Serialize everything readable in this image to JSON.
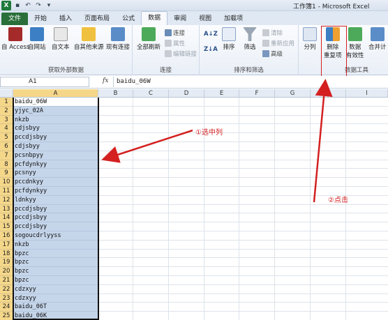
{
  "window": {
    "title": "工作簿1 - Microsoft Excel",
    "app_logo": "X"
  },
  "tabs": [
    {
      "label": "文件"
    },
    {
      "label": "开始"
    },
    {
      "label": "插入"
    },
    {
      "label": "页面布局"
    },
    {
      "label": "公式"
    },
    {
      "label": "数据"
    },
    {
      "label": "审阅"
    },
    {
      "label": "视图"
    },
    {
      "label": "加载项"
    }
  ],
  "ribbon": {
    "external_group": {
      "label": "获取外部数据",
      "access": "自 Access",
      "web": "自网站",
      "text": "自文本",
      "other": "自其他来源",
      "existing": "现有连接"
    },
    "connections_group": {
      "label": "连接",
      "refresh_all": "全部刷新",
      "connections": "连接",
      "properties": "属性",
      "edit_links": "编辑链接"
    },
    "sort_group": {
      "label": "排序和筛选",
      "sort_az": "A↓Z",
      "sort_za": "Z↓A",
      "sort": "排序",
      "filter": "筛选",
      "clear": "清除",
      "reapply": "重新应用",
      "advanced": "高级"
    },
    "tools_group": {
      "label": "数据工具",
      "text_to_columns": "分列",
      "remove_dup_line1": "删除",
      "remove_dup_line2": "重复项",
      "validation_line1": "数据",
      "validation_line2": "有效性",
      "consolidate": "合并计"
    }
  },
  "formula_bar": {
    "name_box": "A1",
    "fx": "fx",
    "value": "baidu_06W"
  },
  "columns": [
    "A",
    "B",
    "C",
    "D",
    "E",
    "F",
    "G",
    "H",
    "I"
  ],
  "rows": [
    {
      "n": "1",
      "a": "baidu_06W"
    },
    {
      "n": "2",
      "a": "yjyc_02A"
    },
    {
      "n": "3",
      "a": "nkzb"
    },
    {
      "n": "4",
      "a": "cdjsbyy"
    },
    {
      "n": "5",
      "a": "pccdjsbyy"
    },
    {
      "n": "6",
      "a": "cdjsbyy"
    },
    {
      "n": "7",
      "a": "pcsnbpyy"
    },
    {
      "n": "8",
      "a": "pcfdynkyy"
    },
    {
      "n": "9",
      "a": "pcsnyy"
    },
    {
      "n": "10",
      "a": "pccdnkyy"
    },
    {
      "n": "11",
      "a": "pcfdynkyy"
    },
    {
      "n": "12",
      "a": "ldnkyy"
    },
    {
      "n": "13",
      "a": "pccdjsbyy"
    },
    {
      "n": "14",
      "a": "pccdjsbyy"
    },
    {
      "n": "15",
      "a": "pccdjsbyy"
    },
    {
      "n": "16",
      "a": "sogoucdrlyyss"
    },
    {
      "n": "17",
      "a": "nkzb"
    },
    {
      "n": "18",
      "a": "bpzc"
    },
    {
      "n": "19",
      "a": "bpzc"
    },
    {
      "n": "20",
      "a": "bpzc"
    },
    {
      "n": "21",
      "a": "bpzc"
    },
    {
      "n": "22",
      "a": "cdzxyy"
    },
    {
      "n": "23",
      "a": "cdzxyy"
    },
    {
      "n": "24",
      "a": "baidu_06T"
    },
    {
      "n": "25",
      "a": "baidu_06K"
    }
  ],
  "annotations": {
    "step1": "①选中列",
    "step2": "②点击"
  },
  "colors": {
    "accent_red": "#d42020",
    "selection_blue": "#c5d5ea",
    "header_selected": "#f5d78a",
    "file_tab": "#2a6f3a"
  }
}
